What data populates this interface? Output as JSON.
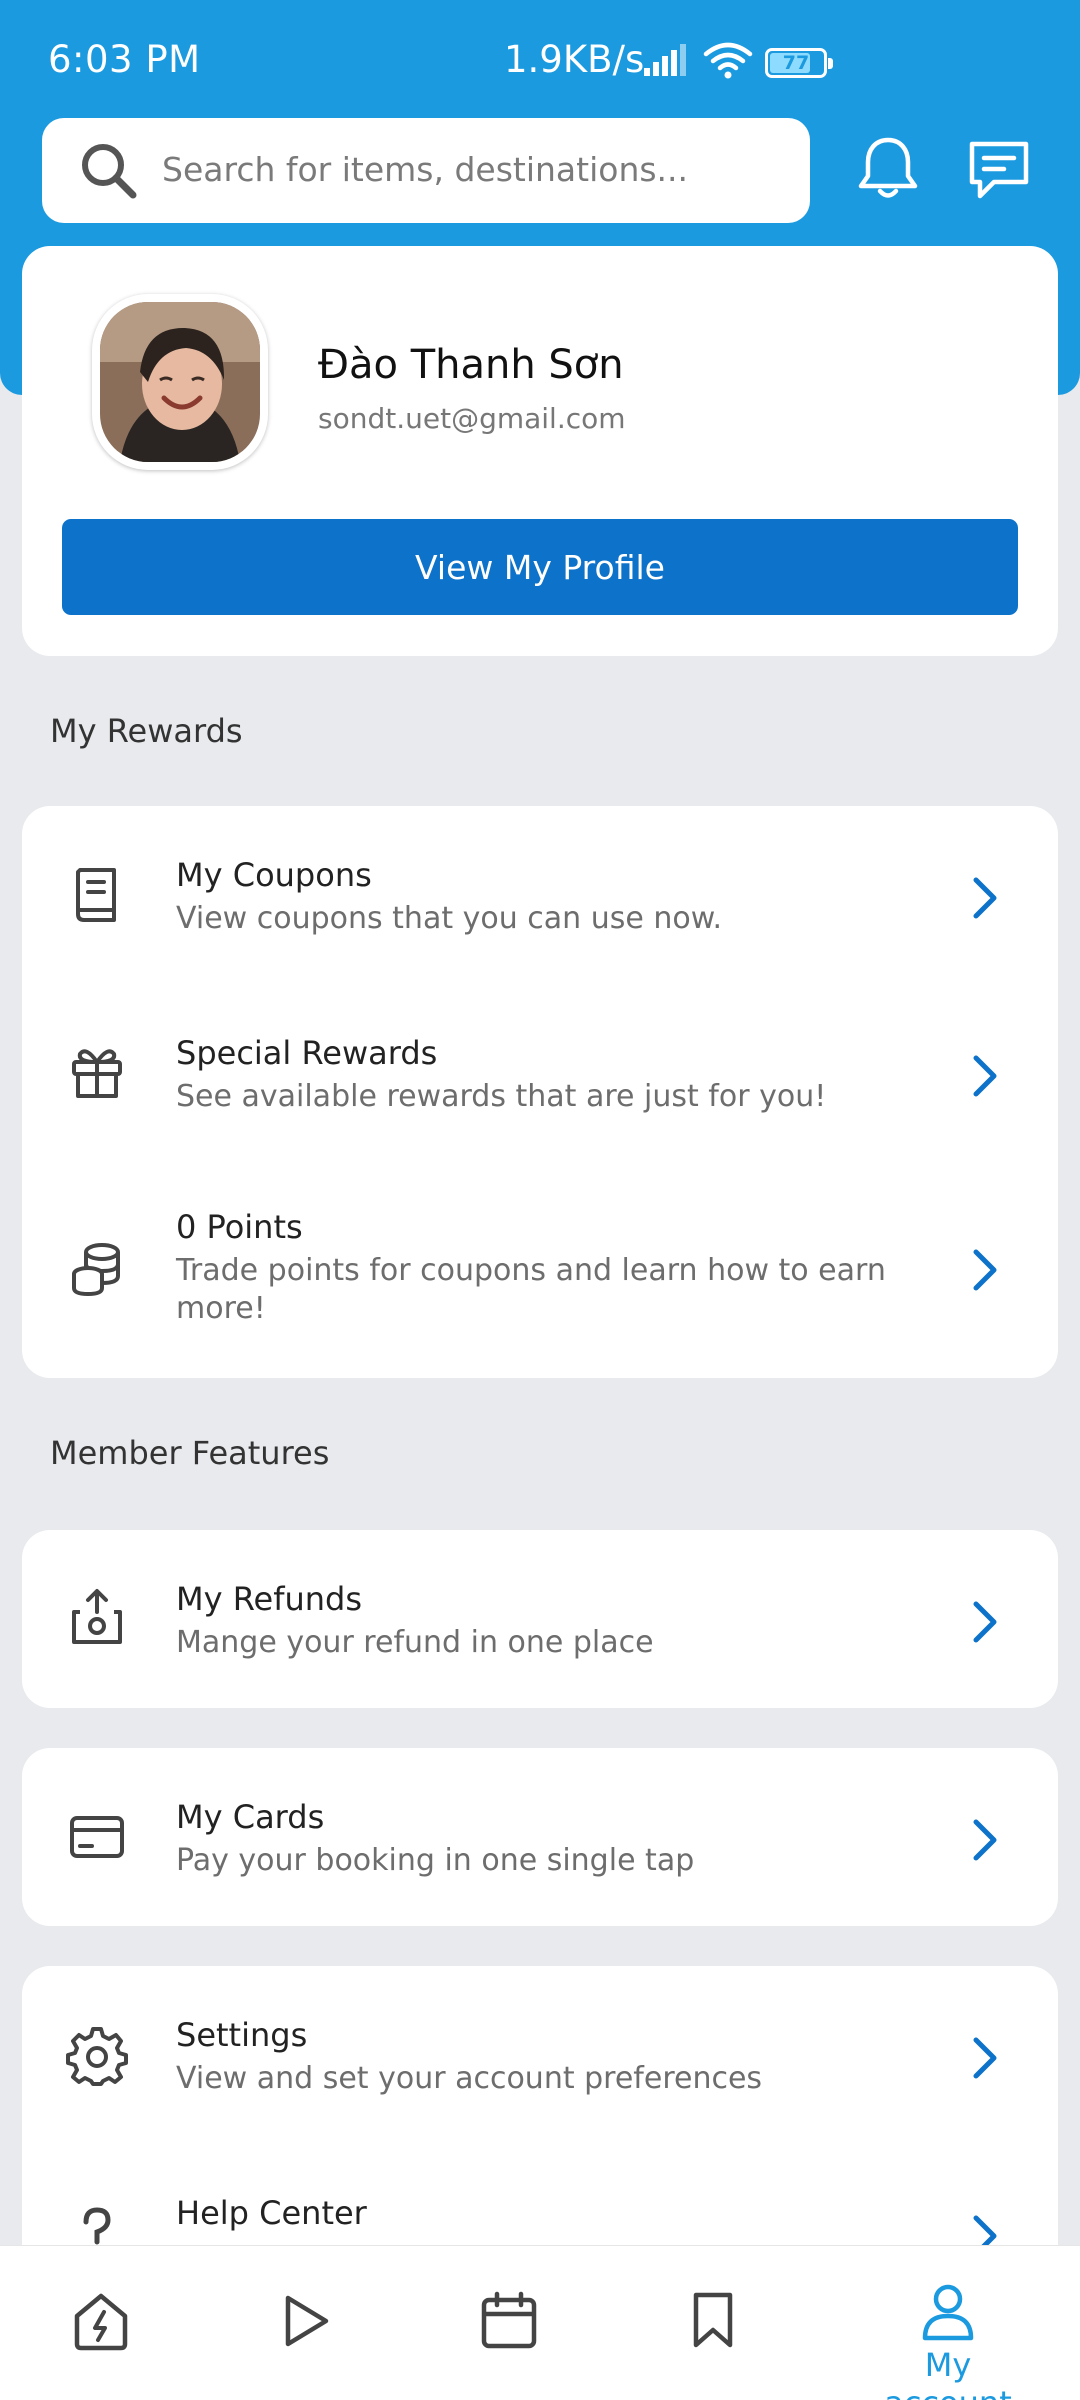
{
  "status_bar": {
    "time": "6:03 PM",
    "network_speed": "1.9KB/s",
    "battery": "77",
    "battery_level": 0.77,
    "icons": [
      "signal-icon",
      "wifi-icon",
      "battery-icon"
    ]
  },
  "header": {
    "search_placeholder": "Search for items, destinations...",
    "icons": [
      "search-icon",
      "bell-icon",
      "chat-icon"
    ]
  },
  "profile": {
    "name": "Đào Thanh Sơn",
    "email": "sondt.uet@gmail.com",
    "view_profile_label": "View My Profile"
  },
  "rewards": {
    "section_label": "My Rewards",
    "items": [
      {
        "title": "My Coupons",
        "subtitle": "View coupons that you can use now.",
        "icon": "coupon-book-icon"
      },
      {
        "title": "Special Rewards",
        "subtitle": "See available rewards that are just for you!",
        "icon": "gift-icon"
      },
      {
        "title": "0 Points",
        "subtitle": "Trade points for coupons and learn how to earn more!",
        "icon": "coins-icon"
      }
    ]
  },
  "member_features": {
    "section_label": "Member Features",
    "items": [
      {
        "title": "My Refunds",
        "subtitle": "Mange your refund in one place",
        "icon": "refund-icon"
      },
      {
        "title": "My Cards",
        "subtitle": "Pay your booking in one single tap",
        "icon": "card-icon"
      },
      {
        "title": "Settings",
        "subtitle": "View and set your account preferences",
        "icon": "gear-icon"
      },
      {
        "title": "Help Center",
        "subtitle": "",
        "icon": "help-icon"
      }
    ]
  },
  "bottom_nav": {
    "items": [
      {
        "icon": "home-icon",
        "label": ""
      },
      {
        "icon": "play-icon",
        "label": ""
      },
      {
        "icon": "calendar-icon",
        "label": ""
      },
      {
        "icon": "bookmark-icon",
        "label": ""
      },
      {
        "icon": "account-icon",
        "label": "My account",
        "active": true
      }
    ]
  },
  "colors": {
    "brand": "#1b9ae0",
    "button": "#0d72c9",
    "chevron": "#0d72c9",
    "background": "#e8eaed"
  }
}
